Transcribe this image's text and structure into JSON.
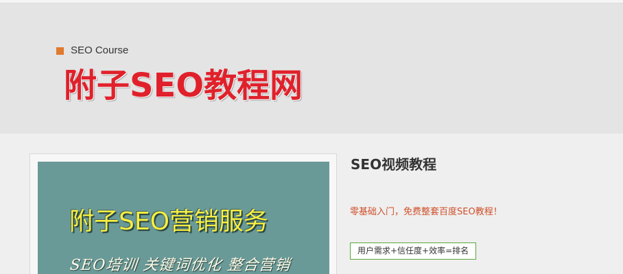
{
  "header": {
    "course_label": "SEO Course",
    "brand_title": "附子SEO教程网",
    "square_icon": "orange-square-bullet",
    "brand_color": "#e0212b",
    "accent_color": "#e07a2f"
  },
  "course_card": {
    "banner_heading": "附子SEO营销服务",
    "banner_subline": "SEO培训 关键词优化 整合营销",
    "banner_color": "#6a9a98",
    "heading_color": "#f7ef40"
  },
  "course_info": {
    "title": "SEO视频教程",
    "description": "零基础入门，免费整套百度SEO教程！",
    "formula": "用户需求+信任度+效率=排名",
    "description_color": "#cf4f2a",
    "border_color": "#59a63b"
  }
}
